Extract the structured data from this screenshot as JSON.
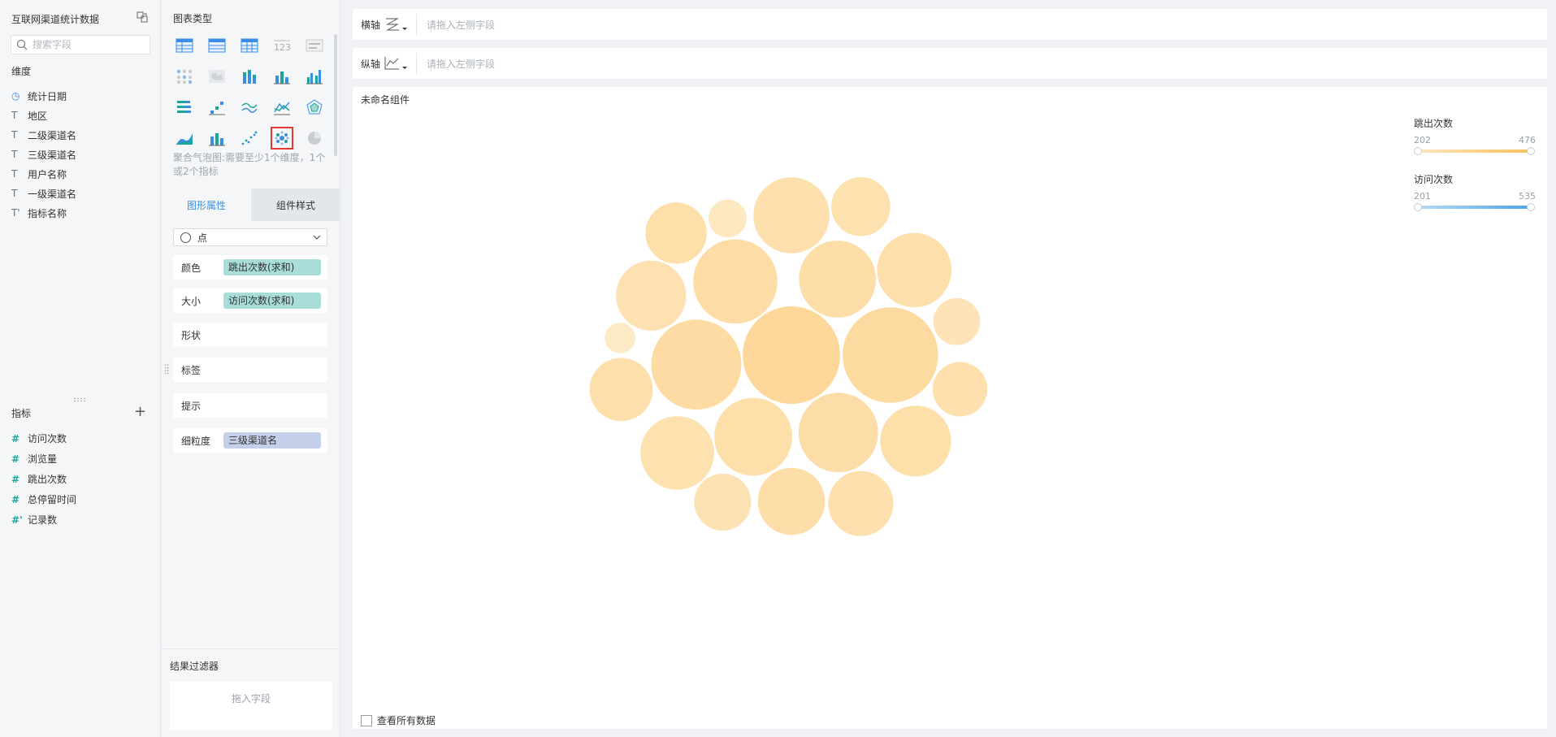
{
  "data_panel": {
    "dataset_title": "互联网渠道统计数据",
    "search_placeholder": "搜索字段",
    "dimensions_label": "维度",
    "dimensions": [
      {
        "label": "统计日期",
        "icon": "clock-icon"
      },
      {
        "label": "地区",
        "icon": "text-type-icon"
      },
      {
        "label": "二级渠道名",
        "icon": "text-type-icon"
      },
      {
        "label": "三级渠道名",
        "icon": "text-type-icon"
      },
      {
        "label": "用户名称",
        "icon": "text-type-icon"
      },
      {
        "label": "一级渠道名",
        "icon": "text-type-icon"
      },
      {
        "label": "指标名称",
        "icon": "text-type-icon"
      }
    ],
    "measures_label": "指标",
    "add_measure_glyph": "+",
    "measures": [
      {
        "label": "访问次数",
        "icon": "number-type-icon"
      },
      {
        "label": "浏览量",
        "icon": "number-type-icon"
      },
      {
        "label": "跳出次数",
        "icon": "number-type-icon"
      },
      {
        "label": "总停留时间",
        "icon": "number-type-icon"
      },
      {
        "label": "记录数",
        "icon": "number-type-icon"
      }
    ]
  },
  "config_panel": {
    "chart_type_title": "图表类型",
    "chart_type_description": "聚合气泡图:需要至少1个维度，1个或2个指标",
    "tabs": [
      {
        "label": "图形属性",
        "active": true
      },
      {
        "label": "组件样式",
        "active": false
      }
    ],
    "shape_select_value": "点",
    "properties": [
      {
        "label": "颜色",
        "pill": "跳出次数(求和)",
        "pill_color": "#a8ded7"
      },
      {
        "label": "大小",
        "pill": "访问次数(求和)",
        "pill_color": "#a8ded7"
      },
      {
        "label": "形状",
        "pill": null
      },
      {
        "label": "标签",
        "pill": null
      },
      {
        "label": "提示",
        "pill": null
      },
      {
        "label": "细粒度",
        "pill": "三级渠道名",
        "pill_color": "#c4d0ea"
      }
    ],
    "result_filter_title": "结果过滤器",
    "result_filter_placeholder": "拖入字段"
  },
  "axes": {
    "x_label": "横轴",
    "y_label": "纵轴",
    "x_placeholder": "请拖入左侧字段",
    "y_placeholder": "请拖入左侧字段"
  },
  "widget": {
    "title": "未命名组件",
    "view_all_label": "查看所有数据"
  },
  "legends": [
    {
      "title": "跳出次数",
      "min": "202",
      "max": "476",
      "color_start": "#fde6bf",
      "color_end": "#f6c15c"
    },
    {
      "title": "访问次数",
      "min": "201",
      "max": "535",
      "color_start": "#b9dcf7",
      "color_end": "#4aa3e8"
    }
  ],
  "colors": {
    "accent": "#3b8ee5",
    "bubble_light": "#fdebc8",
    "bubble_dark": "#fdd89a",
    "selected_border": "#e53935"
  },
  "chart_data": {
    "type": "bubble",
    "color_measure": "跳出次数(求和)",
    "size_measure": "访问次数(求和)",
    "color_range": [
      202,
      476
    ],
    "size_range": [
      201,
      535
    ],
    "bubbles": [
      {
        "size": 535,
        "color": 476
      },
      {
        "size": 520,
        "color": 440
      },
      {
        "size": 480,
        "color": 430
      },
      {
        "size": 440,
        "color": 410
      },
      {
        "size": 410,
        "color": 400
      },
      {
        "size": 400,
        "color": 380
      },
      {
        "size": 395,
        "color": 390
      },
      {
        "size": 390,
        "color": 360
      },
      {
        "size": 380,
        "color": 370
      },
      {
        "size": 375,
        "color": 350
      },
      {
        "size": 360,
        "color": 380
      },
      {
        "size": 355,
        "color": 340
      },
      {
        "size": 340,
        "color": 390
      },
      {
        "size": 330,
        "color": 360
      },
      {
        "size": 320,
        "color": 370
      },
      {
        "size": 310,
        "color": 380
      },
      {
        "size": 300,
        "color": 350
      },
      {
        "size": 290,
        "color": 330
      },
      {
        "size": 280,
        "color": 360
      },
      {
        "size": 250,
        "color": 300
      },
      {
        "size": 220,
        "color": 240
      },
      {
        "size": 201,
        "color": 202
      }
    ]
  }
}
